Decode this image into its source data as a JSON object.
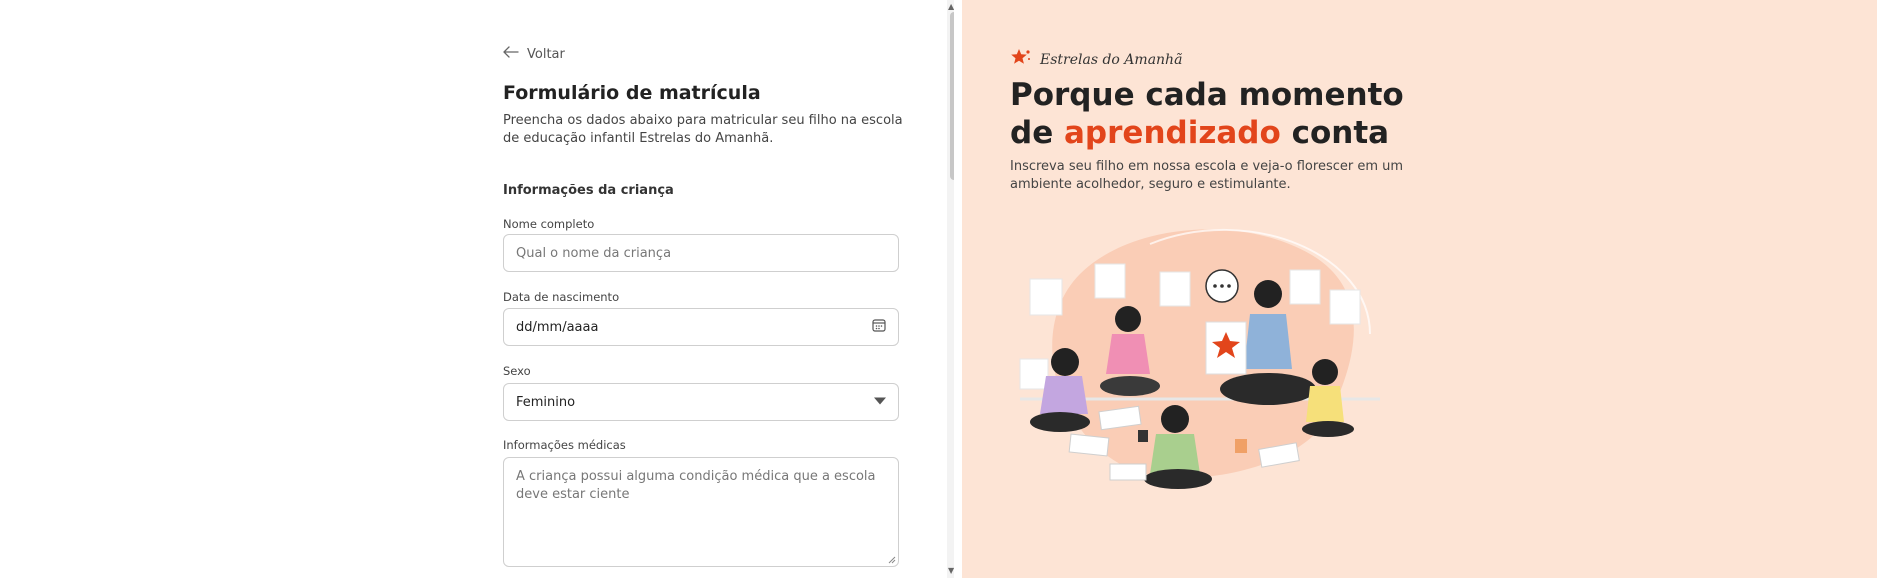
{
  "form": {
    "back_label": "Voltar",
    "title": "Formulário de matrícula",
    "description": "Preencha os dados abaixo para matricular seu filho na escola de educação infantil Estrelas do Amanhã.",
    "section_title": "Informações da criança",
    "fields": {
      "name": {
        "label": "Nome completo",
        "placeholder": "Qual o nome da criança"
      },
      "birth": {
        "label": "Data de nascimento",
        "value": "dd/mm/aaaa"
      },
      "sex": {
        "label": "Sexo",
        "value": "Feminino"
      },
      "medical": {
        "label": "Informações médicas",
        "placeholder": "A criança possui alguma condição médica que a escola deve estar ciente"
      }
    }
  },
  "hero": {
    "brand_name": "Estrelas do Amanhã",
    "title_part1": "Porque cada momento de ",
    "title_accent": "aprendizado",
    "title_part2": " conta",
    "description": "Inscreva seu filho em nossa escola e veja-o florescer em um ambiente acolhedor, seguro e estimulante."
  },
  "icons": {
    "back": "arrow-left-icon",
    "calendar": "calendar-icon",
    "dropdown": "chevron-down-icon",
    "brand": "star-logo-icon"
  },
  "colors": {
    "accent": "#e2451b",
    "hero_bg": "#fde4d5"
  }
}
